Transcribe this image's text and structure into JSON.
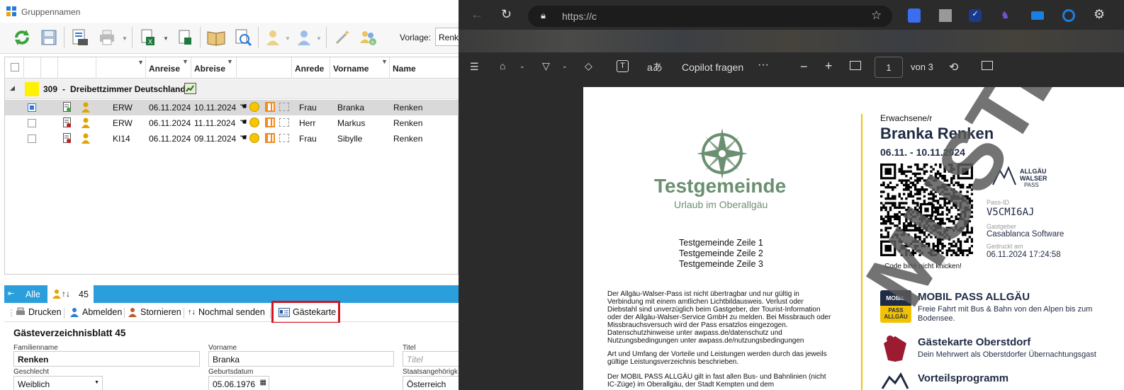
{
  "app": {
    "title": "Gruppennamen",
    "vorlage_label": "Vorlage:",
    "vorlage_value": "Renk",
    "columns": [
      "Anreise",
      "Abreise",
      "Anrede",
      "Vorname",
      "Name"
    ],
    "group": {
      "room": "309",
      "separator": "-",
      "name": "Dreibettzimmer Deutschland"
    },
    "rows": [
      {
        "type": "ERW",
        "arrival": "06.11.2024",
        "departure": "10.11.2024",
        "salutation": "Frau",
        "first": "Branka",
        "last": "Renken"
      },
      {
        "type": "ERW",
        "arrival": "06.11.2024",
        "departure": "11.11.2024",
        "salutation": "Herr",
        "first": "Markus",
        "last": "Renken"
      },
      {
        "type": "KI14",
        "arrival": "06.11.2024",
        "departure": "09.11.2024",
        "salutation": "Frau",
        "first": "Sibylle",
        "last": "Renken"
      }
    ],
    "tabs": {
      "all": "Alle",
      "count": "45"
    },
    "actions": {
      "print": "Drucken",
      "logout": "Abmelden",
      "cancel": "Stornieren",
      "resend": "Nochmal senden",
      "guestcard": "Gästekarte"
    },
    "form": {
      "title": "Gästeverzeichnisblatt 45",
      "lastname_label": "Familienname",
      "lastname": "Renken",
      "firstname_label": "Vorname",
      "firstname": "Branka",
      "title_label": "Titel",
      "title_placeholder": "Titel",
      "gender_label": "Geschlecht",
      "gender": "Weiblich",
      "birth_label": "Geburtsdatum",
      "birth": "05.06.1976",
      "nation_label": "Staatsangehörigk",
      "nation": "Österreich"
    }
  },
  "browser": {
    "url": "https://c",
    "copilot": "Copilot fragen",
    "page": "1",
    "page_of": "von 3"
  },
  "pass": {
    "brand": "Testgemeinde",
    "brand_sub": "Urlaub im Oberallgäu",
    "lines": [
      "Testgemeinde Zeile 1",
      "Testgemeinde Zeile 2",
      "Testgemeinde Zeile 3"
    ],
    "legal1": "Der Allgäu-Walser-Pass ist nicht übertragbar und nur gültig in Verbindung mit einem amtlichen Lichtbildausweis. Verlust oder Diebstahl sind unverzüglich beim Gastgeber, der Tourist-Information oder der Allgäu-Walser-Service GmbH zu melden. Bei Missbrauch oder Missbrauchsversuch wird der Pass ersatzlos eingezogen. Datenschutzhinweise unter awpass.de/datenschutz und Nutzungsbedingungen unter awpass.de/nutzungsbedingungen",
    "legal2": "Art und Umfang der Vorteile und Leistungen werden durch das jeweils gültige Leistungsverzeichnis beschrieben.",
    "legal3": "Der MOBIL PASS ALLGÄU gilt in fast allen Bus- und Bahnlinien (nicht IC-Züge) im Oberallgäu, der Stadt Kempten und dem",
    "category": "Erwachsene/r",
    "name": "Branka Renken",
    "dates": "06.11. - 10.11.2024",
    "logo_line1": "ALLGÄU",
    "logo_line2": "WALSER",
    "logo_line3": "PASS",
    "passid_label": "Pass-ID",
    "passid": "V5CMI6AJ",
    "host_label": "Gastgeber",
    "host": "Casablanca Software",
    "printed_label": "Gedruckt am",
    "printed": "06.11.2024 17:24:58",
    "qr_note": "Code bitte nicht knicken!",
    "mobil_badge1": "MOBIL",
    "mobil_badge2": "PASS",
    "mobil_badge3": "ALLGÄU",
    "mobil_title": "MOBIL PASS ALLGÄU",
    "mobil_text": "Freie Fahrt mit Bus & Bahn von den Alpen bis zum Bodensee.",
    "gk_title": "Gästekarte Oberstdorf",
    "gk_text": "Dein Mehrwert als Oberstdorfer Übernachtungsgast",
    "vp_title": "Vorteilsprogramm",
    "watermark": "MUSTER"
  },
  "colors": {
    "blue": "#2b9fdc",
    "red": "#d2161e",
    "green": "#6b8f71",
    "navy": "#1f2a44",
    "yellow": "#f2c200"
  }
}
